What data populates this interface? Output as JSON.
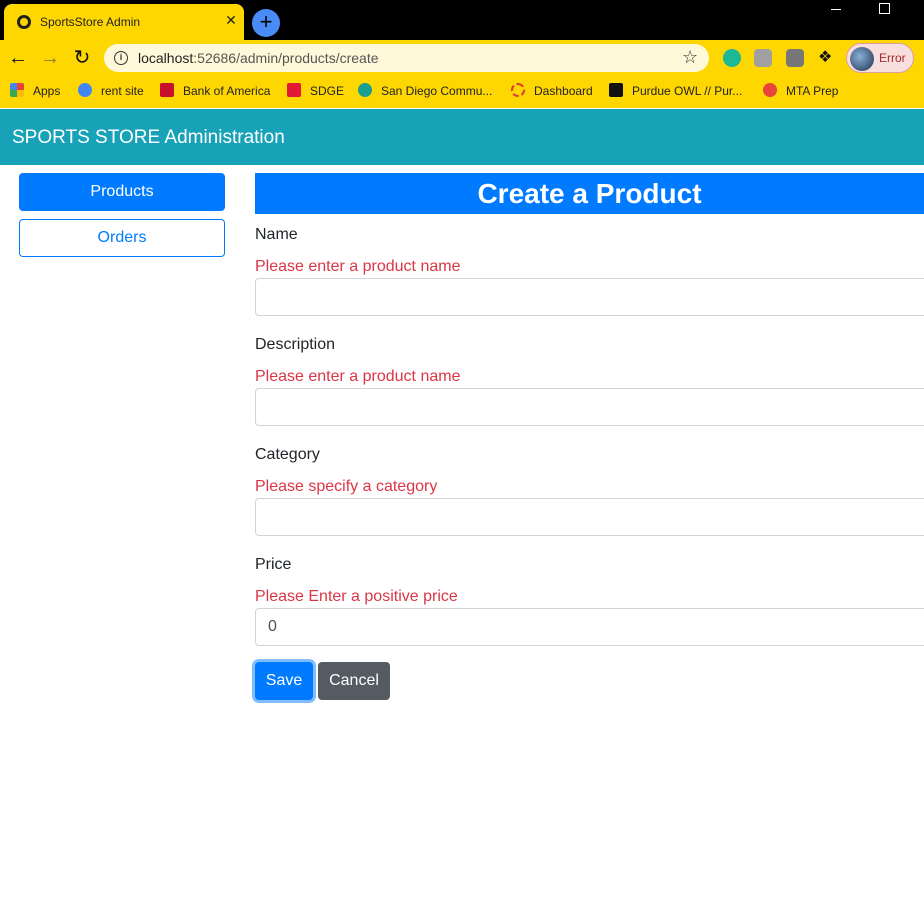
{
  "browser": {
    "tab_title": "SportsStore Admin",
    "tab_close": "✕",
    "new_tab": "+",
    "url_host": "localhost",
    "url_path": ":52686/admin/products/create",
    "profile_label": "Error",
    "bookmarks": [
      {
        "label": "Apps",
        "icon_color": "#e44d26"
      },
      {
        "label": "rent site",
        "icon_color": "#4285f4"
      },
      {
        "label": "Bank of America",
        "icon_color": "#c8102e"
      },
      {
        "label": "SDGE",
        "icon_color": "#e31837"
      },
      {
        "label": "San Diego Commu...",
        "icon_color": "#1a9e8f"
      },
      {
        "label": "Dashboard",
        "icon_color": "#e03c31"
      },
      {
        "label": "Purdue OWL // Pur...",
        "icon_color": "#000000"
      },
      {
        "label": "MTA Prep",
        "icon_color": "#e8453c"
      }
    ]
  },
  "app": {
    "title": "SPORTS STORE Administration",
    "nav": {
      "products": "Products",
      "orders": "Orders"
    },
    "heading": "Create a Product",
    "form": {
      "name_label": "Name",
      "name_error": "Please enter a product name",
      "name_value": "",
      "description_label": "Description",
      "description_error": "Please enter a product name",
      "description_value": "",
      "category_label": "Category",
      "category_error": "Please specify a category",
      "category_value": "",
      "price_label": "Price",
      "price_error": "Please Enter a positive price",
      "price_value": "0"
    },
    "buttons": {
      "save": "Save",
      "cancel": "Cancel"
    }
  },
  "colors": {
    "header": "#17a2b8",
    "primary": "#007bff",
    "danger": "#dc3545",
    "secondary": "#545b62",
    "browser_theme": "#ffd700"
  }
}
